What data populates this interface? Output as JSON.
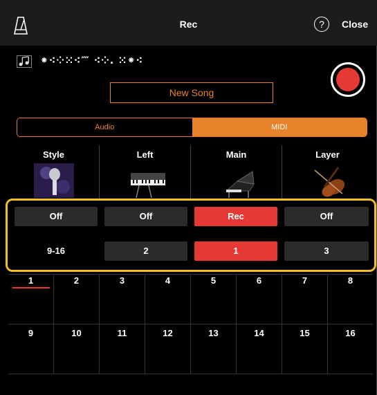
{
  "header": {
    "title": "Rec",
    "help_glyph": "?",
    "close_label": "Close",
    "metronome_icon": "metronome-icon"
  },
  "song": {
    "name": "⁕⁖⁘⁙⁖⁗ ⁖⁘. ⁙⁕⁖",
    "note_icon": "music-note-icon",
    "new_song_label": "New Song"
  },
  "mode_tabs": {
    "audio": "Audio",
    "midi": "MIDI",
    "selected": "MIDI"
  },
  "parts": [
    {
      "label": "Style",
      "icon": "microphone-image"
    },
    {
      "label": "Left",
      "icon": "keyboard-image"
    },
    {
      "label": "Main",
      "icon": "grand-piano-image"
    },
    {
      "label": "Layer",
      "icon": "violin-image"
    }
  ],
  "track_status": [
    "Off",
    "Off",
    "Rec",
    "Off"
  ],
  "track_channels": [
    "9-16",
    "2",
    "1",
    "3"
  ],
  "grid": {
    "row1": [
      "1",
      "2",
      "3",
      "4",
      "5",
      "6",
      "7",
      "8"
    ],
    "row2": [
      "9",
      "10",
      "11",
      "12",
      "13",
      "14",
      "15",
      "16"
    ],
    "selected": "1"
  },
  "colors": {
    "accent": "#e8822b",
    "rec_red": "#e53935",
    "highlight": "#f3be29"
  }
}
